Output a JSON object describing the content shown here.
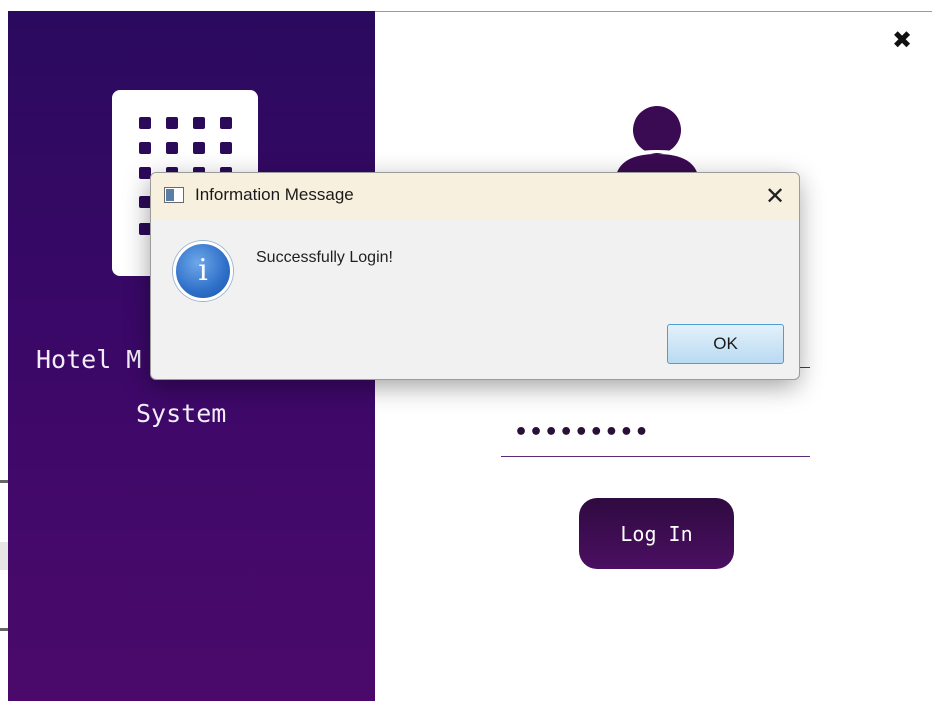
{
  "app": {
    "title_line1": "Hotel M",
    "title_line2": "System",
    "close_glyph": "✖",
    "password_mask": "•••••••••",
    "login_label": "Log In"
  },
  "dialog": {
    "title": "Information Message",
    "close_glyph": "✕",
    "message": "Successfully Login!",
    "info_glyph": "i",
    "ok_label": "OK"
  },
  "icons": {
    "logo": "hotel-building-icon",
    "user": "user-icon",
    "info": "info-icon",
    "title_window": "window-icon"
  },
  "colors": {
    "panel_top": "#2a0a5e",
    "panel_bottom": "#4b0a6b",
    "login_button": "#3e0c52",
    "dialog_title_bar": "#f8f0de",
    "ok_button_border": "#4d9dd6"
  }
}
